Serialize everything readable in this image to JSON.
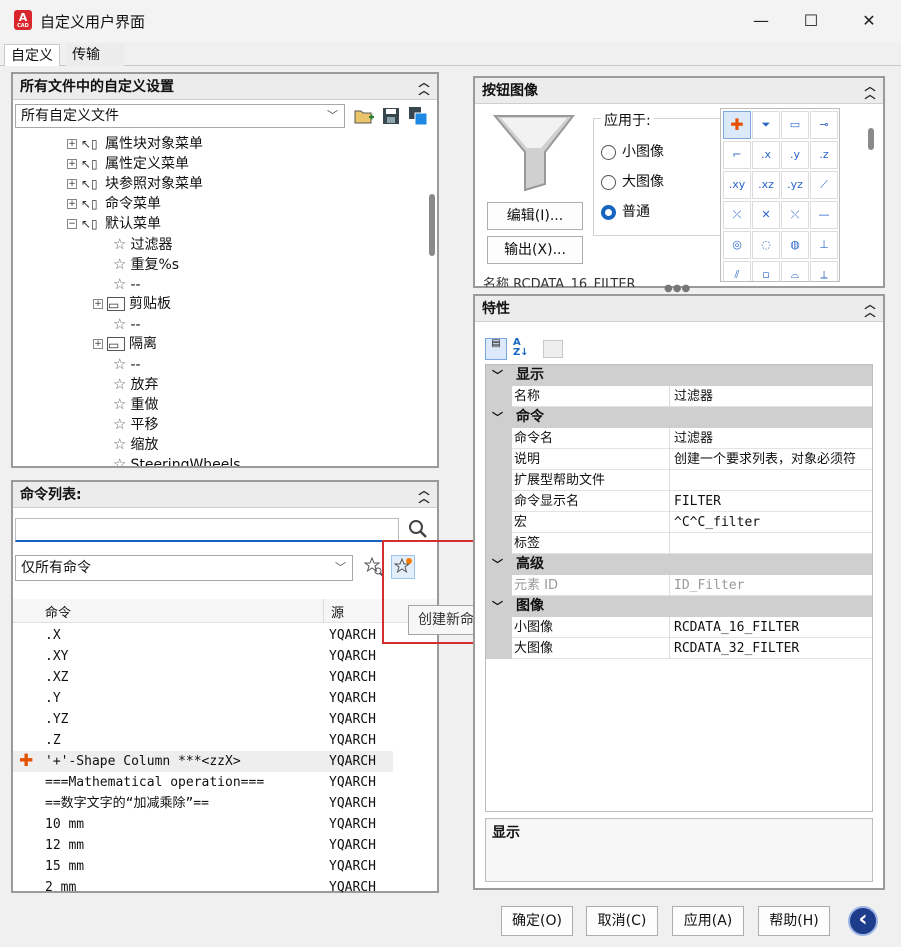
{
  "window": {
    "title": "自定义用户界面",
    "min": "—",
    "max": "☐",
    "close": "✕",
    "app_icon_letter": "A",
    "app_icon_sub": "CAD"
  },
  "tabs": [
    {
      "label": "自定义"
    },
    {
      "label": "传输"
    }
  ],
  "customizations": {
    "title": "所有文件中的自定义设置",
    "file_select": "所有自定义文件",
    "tree": [
      {
        "label": "属性块对象菜单",
        "kind": "menu",
        "expander": "+",
        "level": 0
      },
      {
        "label": "属性定义菜单",
        "kind": "menu",
        "expander": "+",
        "level": 0
      },
      {
        "label": "块参照对象菜单",
        "kind": "menu",
        "expander": "+",
        "level": 0
      },
      {
        "label": "命令菜单",
        "kind": "menu",
        "expander": "+",
        "level": 0
      },
      {
        "label": "默认菜单",
        "kind": "menu",
        "expander": "−",
        "level": 0
      },
      {
        "label": "过滤器",
        "kind": "cmd",
        "level": 1
      },
      {
        "label": "重复%s",
        "kind": "cmd",
        "level": 1
      },
      {
        "label": "--",
        "kind": "cmd",
        "level": 1
      },
      {
        "label": "剪贴板",
        "kind": "sub",
        "expander": "+",
        "level": 1
      },
      {
        "label": "--",
        "kind": "cmd",
        "level": 1
      },
      {
        "label": "隔离",
        "kind": "sub",
        "expander": "+",
        "level": 1
      },
      {
        "label": "--",
        "kind": "cmd",
        "level": 1
      },
      {
        "label": "放弃",
        "kind": "cmd",
        "level": 1
      },
      {
        "label": "重做",
        "kind": "cmd",
        "level": 1
      },
      {
        "label": "平移",
        "kind": "cmd",
        "level": 1
      },
      {
        "label": "缩放",
        "kind": "cmd",
        "level": 1
      },
      {
        "label": "SteeringWheels",
        "kind": "cmd",
        "level": 1
      }
    ]
  },
  "command_list": {
    "title": "命令列表:",
    "search_value": "",
    "filter_select": "仅所有命令",
    "columns": {
      "command": "命令",
      "source": "源"
    },
    "tooltip": "创建新命令",
    "rows": [
      {
        "name": ".X",
        "source": "YQARCH"
      },
      {
        "name": ".XY",
        "source": "YQARCH"
      },
      {
        "name": ".XZ",
        "source": "YQARCH"
      },
      {
        "name": ".Y",
        "source": "YQARCH"
      },
      {
        "name": ".YZ",
        "source": "YQARCH"
      },
      {
        "name": ".Z",
        "source": "YQARCH"
      },
      {
        "name": "'+'-Shape Column    ***<zzX>",
        "source": "YQARCH",
        "icon": "cross-shape"
      },
      {
        "name": "===Mathematical operation===",
        "source": "YQARCH"
      },
      {
        "name": "==数字文字的“加减乘除”==",
        "source": "YQARCH"
      },
      {
        "name": "10   mm",
        "source": "YQARCH"
      },
      {
        "name": "12   mm",
        "source": "YQARCH"
      },
      {
        "name": "15   mm",
        "source": "YQARCH"
      },
      {
        "name": "2   mm",
        "source": "YQARCH"
      }
    ]
  },
  "button_image": {
    "title": "按钮图像",
    "edit_label": "编辑(I)...",
    "export_label": "输出(X)...",
    "apply_to_label": "应用于:",
    "options": [
      {
        "label": "小图像",
        "selected": false
      },
      {
        "label": "大图像",
        "selected": false
      },
      {
        "label": "普通",
        "selected": true
      }
    ],
    "name_partial": "名称    RCDATA_16_FILTER",
    "icons": [
      "✚",
      "⏷",
      "▭",
      "⊸",
      "⌐",
      ".x",
      ".y",
      ".z",
      ".xy",
      ".xz",
      ".yz",
      "⟋",
      "⤫",
      "✕",
      "⤬",
      "—",
      "◎",
      "◌",
      "◍",
      "⊥",
      "⫽",
      "▫",
      "⌓",
      "⟂"
    ]
  },
  "properties": {
    "title": "特性",
    "categories": [
      {
        "name": "显示",
        "rows": [
          {
            "name": "名称",
            "value": "过滤器"
          }
        ]
      },
      {
        "name": "命令",
        "rows": [
          {
            "name": "命令名",
            "value": "过滤器"
          },
          {
            "name": "说明",
            "value": "创建一个要求列表，对象必须符"
          },
          {
            "name": "扩展型帮助文件",
            "value": ""
          },
          {
            "name": "命令显示名",
            "value": "FILTER",
            "mono": true
          },
          {
            "name": "宏",
            "value": "^C^C_filter",
            "mono": true
          },
          {
            "name": "标签",
            "value": ""
          }
        ]
      },
      {
        "name": "高级",
        "rows": [
          {
            "name": "元素 ID",
            "value": "ID_Filter",
            "mono": true,
            "disabled": true
          }
        ]
      },
      {
        "name": "图像",
        "rows": [
          {
            "name": "小图像",
            "value": "RCDATA_16_FILTER",
            "mono": true
          },
          {
            "name": "大图像",
            "value": "RCDATA_32_FILTER",
            "mono": true
          }
        ]
      }
    ],
    "description_title": "显示"
  },
  "footer": {
    "ok": "确定(O)",
    "cancel": "取消(C)",
    "apply": "应用(A)",
    "help": "帮助(H)",
    "back": "‹"
  },
  "colors": {
    "accent": "#1565c0",
    "highlight_box": "#d32f2f",
    "header_gray": "#cfcfcf"
  }
}
